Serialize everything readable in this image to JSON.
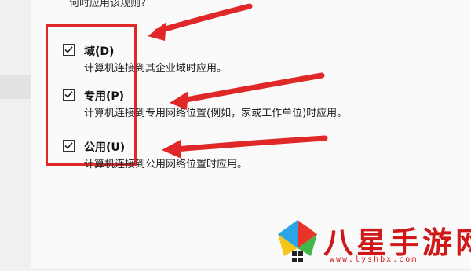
{
  "header": {
    "partial_text": "何时应用该规则?"
  },
  "options": [
    {
      "label": "域(D)",
      "description": "计算机连接到其企业域时应用。",
      "checked": true
    },
    {
      "label": "专用(P)",
      "description": "计算机连接到专用网络位置(例如，家或工作单位)时应用。",
      "checked": true
    },
    {
      "label": "公用(U)",
      "description": "计算机连接到公用网络位置时应用。",
      "checked": true
    }
  ],
  "annotation": {
    "box_color": "#e02828",
    "arrow_color": "#e02828"
  },
  "watermark": {
    "name": "八星手游网",
    "url": "www.lyshbx.com",
    "color": "#d01818"
  }
}
